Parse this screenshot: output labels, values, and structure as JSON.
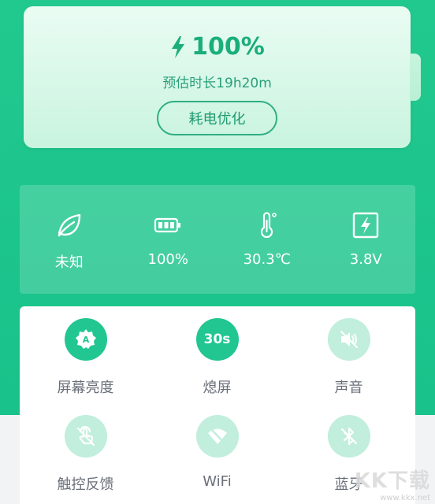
{
  "battery": {
    "level": "100%",
    "estimate": "预估时长19h20m",
    "optimize_label": "耗电优化",
    "icon": "lightning-icon"
  },
  "stats": [
    {
      "name": "health",
      "icon": "leaf-icon",
      "value": "未知"
    },
    {
      "name": "level",
      "icon": "battery-icon",
      "value": "100%"
    },
    {
      "name": "temperature",
      "icon": "thermometer-icon",
      "value": "30.3℃"
    },
    {
      "name": "voltage",
      "icon": "voltage-icon",
      "value": "3.8V"
    }
  ],
  "quick_settings": [
    {
      "label": "屏幕亮度",
      "icon": "brightness-auto-icon",
      "state": "on"
    },
    {
      "label": "熄屏",
      "icon": "timeout-icon",
      "badge": "30s",
      "state": "on"
    },
    {
      "label": "声音",
      "icon": "mute-icon",
      "state": "off"
    },
    {
      "label": "触控反馈",
      "icon": "touch-icon",
      "state": "off"
    },
    {
      "label": "WiFi",
      "icon": "wifi-off-icon",
      "state": "off"
    },
    {
      "label": "蓝牙",
      "icon": "bluetooth-off-icon",
      "state": "off"
    }
  ],
  "watermark": {
    "logo": "KK下载",
    "url": "www.kkx.net"
  },
  "colors": {
    "primary": "#21c690",
    "toggle_off": "#c1eedd",
    "label": "#6b6f7a"
  }
}
